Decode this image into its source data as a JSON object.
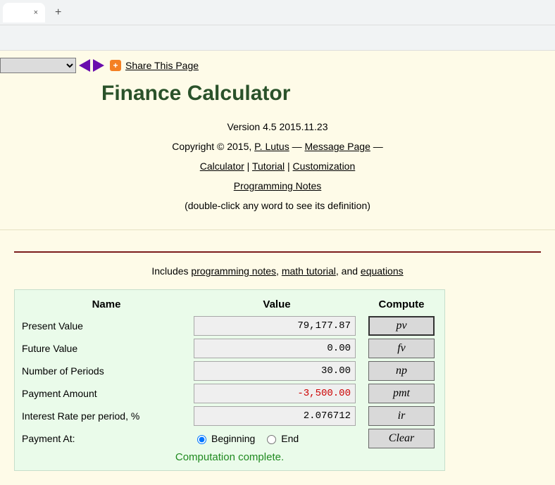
{
  "browser": {
    "close_glyph": "×",
    "add_glyph": "+"
  },
  "nav": {
    "share_plus": "+",
    "share_text": " Share This Page"
  },
  "header": {
    "title": "Finance Calculator",
    "version": "Version 4.5 2015.11.23",
    "copyright_prefix": "Copyright © 2015, ",
    "author": "P. Lutus",
    "dash1": " — ",
    "message_page": "Message Page",
    "dash2": " —",
    "link_calculator": "Calculator",
    "sep": " | ",
    "link_tutorial": "Tutorial",
    "link_customization": "Customization",
    "link_prognotes": "Programming Notes",
    "hint": "(double-click any word to see its definition)"
  },
  "includes": {
    "prefix": "Includes ",
    "l1": "programming notes",
    "c1": ", ",
    "l2": "math tutorial",
    "c2": ", and ",
    "l3": "equations"
  },
  "calc": {
    "head_name": "Name",
    "head_value": "Value",
    "head_compute": "Compute",
    "rows": [
      {
        "label": "Present Value",
        "value": "79,177.87",
        "btn": "pv",
        "neg": false,
        "thick": true
      },
      {
        "label": "Future Value",
        "value": "0.00",
        "btn": "fv",
        "neg": false,
        "thick": false
      },
      {
        "label": "Number of Periods",
        "value": "30.00",
        "btn": "np",
        "neg": false,
        "thick": false
      },
      {
        "label": "Payment Amount",
        "value": "-3,500.00",
        "btn": "pmt",
        "neg": true,
        "thick": false
      },
      {
        "label": "Interest Rate per period, %",
        "value": "2.076712",
        "btn": "ir",
        "neg": false,
        "thick": false
      }
    ],
    "pay_at_label": "Payment At:",
    "opt_begin": "Beginning",
    "opt_end": "End",
    "clear_btn": "Clear",
    "status": "Computation complete."
  }
}
